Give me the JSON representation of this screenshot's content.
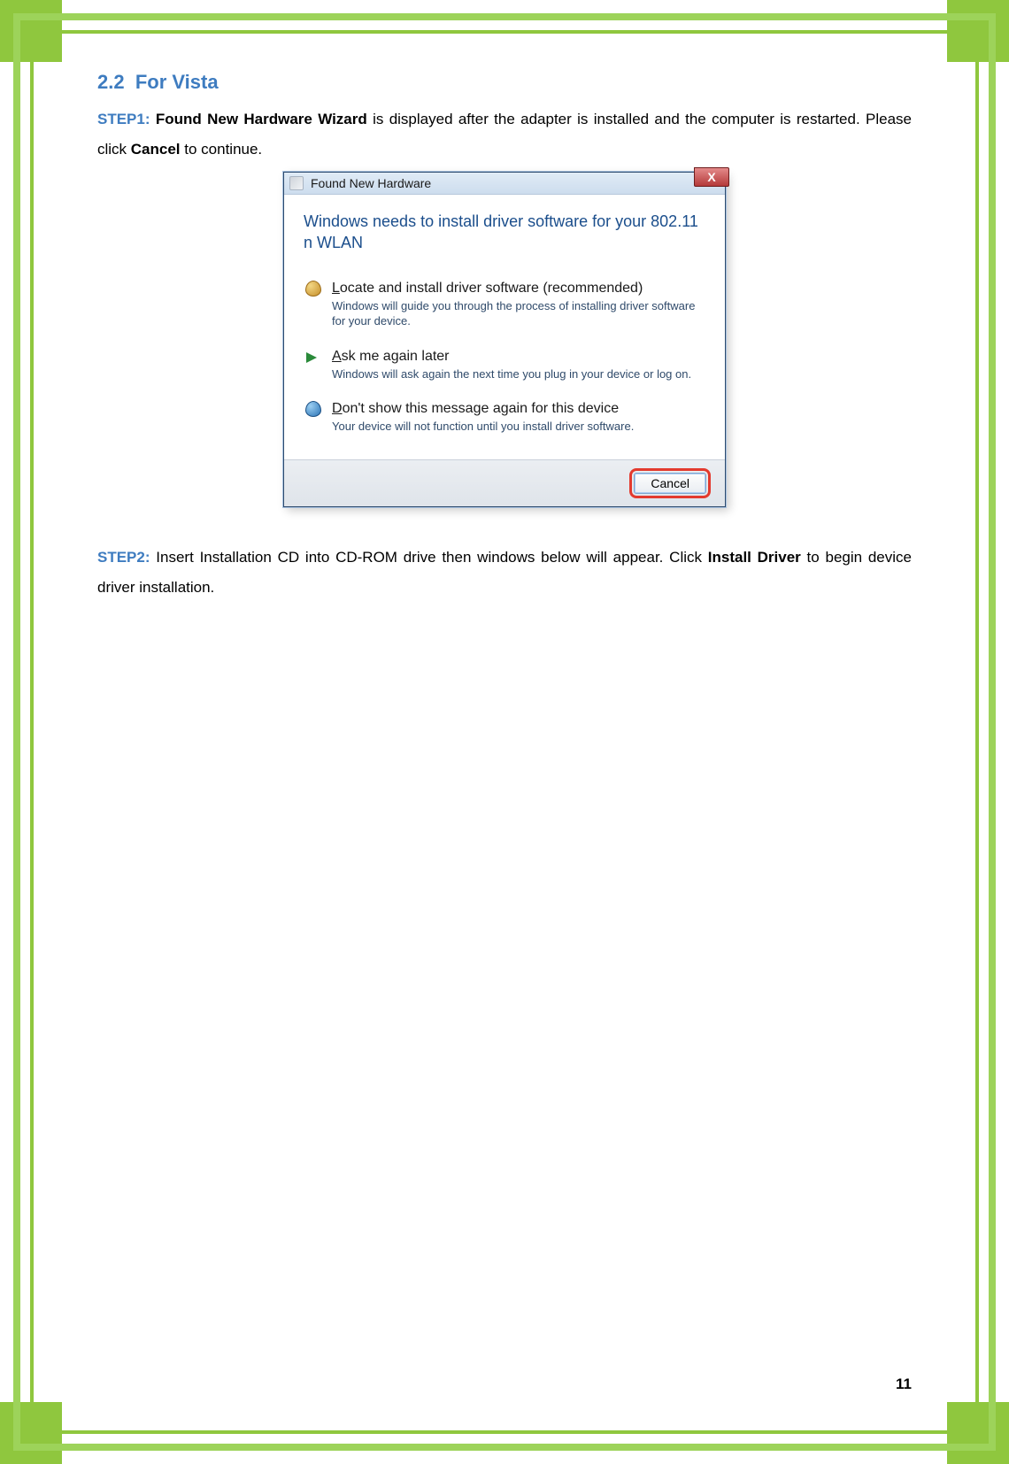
{
  "section": {
    "number": "2.2",
    "title": "For Vista"
  },
  "step1": {
    "label": "STEP1:",
    "bold_a": "Found New Hardware Wizard",
    "text_a": " is displayed after the adapter is installed and the computer is restarted. Please click ",
    "bold_b": "Cancel",
    "text_b": " to continue."
  },
  "dialog": {
    "title": "Found New Hardware",
    "close_x": "X",
    "heading": "Windows needs to install driver software for your 802.11 n WLAN",
    "opt1": {
      "underline_char": "L",
      "title_rest": "ocate and install driver software (recommended)",
      "desc": "Windows will guide you through the process of installing driver software for your device."
    },
    "opt2": {
      "underline_char": "A",
      "title_rest": "sk me again later",
      "desc": "Windows will ask again the next time you plug in your device or log on."
    },
    "opt3": {
      "underline_char": "D",
      "title_rest": "on't show this message again for this device",
      "desc": "Your device will not function until you install driver software."
    },
    "cancel": "Cancel"
  },
  "step2": {
    "label": "STEP2:",
    "text_a": " Insert Installation CD into CD-ROM drive then windows below will appear. Click ",
    "bold_a": "Install Driver",
    "text_b": " to begin device driver installation."
  },
  "page_number": "11"
}
